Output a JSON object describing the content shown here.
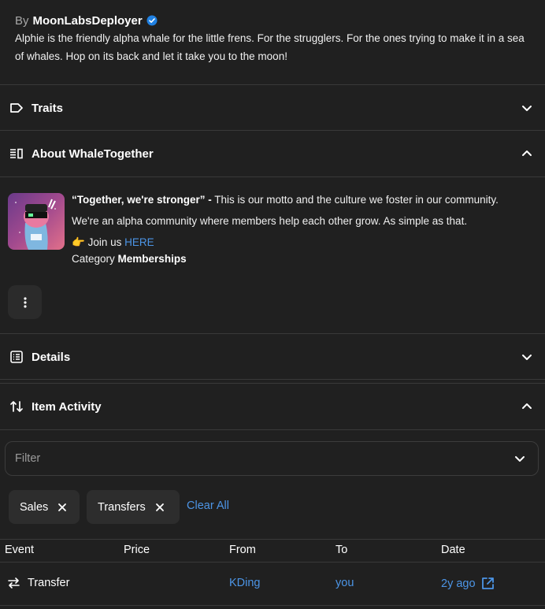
{
  "creator": {
    "by_label": "By",
    "name": "MoonLabsDeployer"
  },
  "description": "Alphie is the friendly alpha whale for the little frens. For the strugglers. For the ones trying to make it in a sea of whales. Hop on its back and let it take you to the moon!",
  "sections": {
    "traits": {
      "title": "Traits"
    },
    "about": {
      "title": "About WhaleTogether"
    },
    "details": {
      "title": "Details"
    },
    "activity": {
      "title": "Item Activity"
    }
  },
  "about": {
    "motto_bold": "“Together, we're stronger” -",
    "motto_rest": " This is our motto and the culture we foster in our community.",
    "line2": "We're an alpha community where members help each other grow. As simple as that.",
    "join_emoji": "👉",
    "join_prefix": " Join us ",
    "join_link": "HERE",
    "category_label": "Category",
    "category_value": "Memberships"
  },
  "filter": {
    "placeholder": "Filter",
    "chips": [
      "Sales",
      "Transfers"
    ],
    "clear_all": "Clear All"
  },
  "table": {
    "headers": [
      "Event",
      "Price",
      "From",
      "To",
      "Date"
    ],
    "rows": [
      {
        "event": "Transfer",
        "price": "",
        "from": "KDing",
        "to": "you",
        "date": "2y ago"
      }
    ]
  },
  "colors": {
    "background": "#202020",
    "link": "#4c95e6",
    "verified": "#2081e2"
  }
}
